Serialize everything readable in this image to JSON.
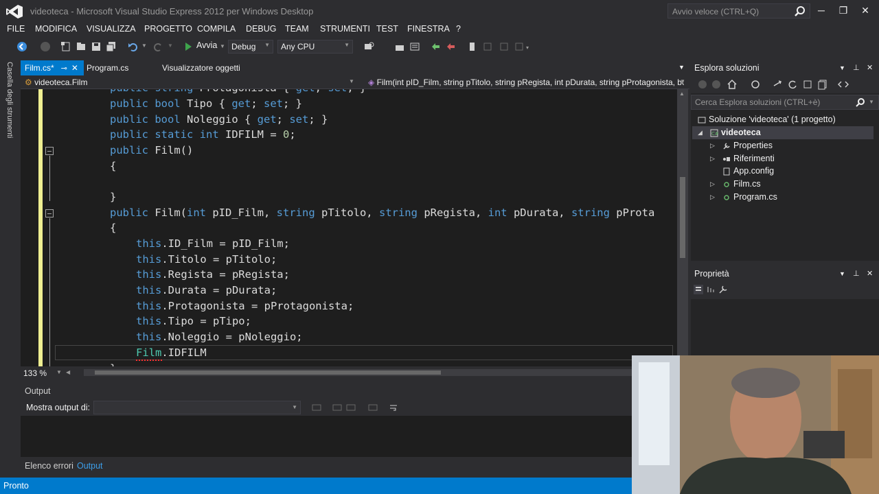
{
  "window": {
    "title": "videoteca - Microsoft Visual Studio Express 2012 per Windows Desktop",
    "quick_launch_placeholder": "Avvio veloce (CTRL+Q)"
  },
  "menu": [
    "FILE",
    "MODIFICA",
    "VISUALIZZA",
    "PROGETTO",
    "COMPILA",
    "DEBUG",
    "TEAM",
    "STRUMENTI",
    "TEST",
    "FINESTRA",
    "?"
  ],
  "toolbar": {
    "start_label": "Avvia",
    "configuration": "Debug",
    "platform": "Any CPU"
  },
  "toolbox_label": "Casella degli strumenti",
  "tabs": [
    {
      "label": "Film.cs*",
      "active": true
    },
    {
      "label": "Program.cs",
      "active": false
    },
    {
      "label": "Visualizzatore oggetti",
      "active": false
    }
  ],
  "navbar": {
    "type": "videoteca.Film",
    "member": "Film(int pID_Film, string pTitolo, string pRegista, int pDurata, string pProtagonista, bo"
  },
  "code": [
    "    public string Protagonista { get; set; }",
    "    public bool Tipo { get; set; }",
    "    public bool Noleggio { get; set; }",
    "    public static int IDFILM = 0;",
    "    public Film()",
    "    {",
    "",
    "    }",
    "    public Film(int pID_Film, string pTitolo, string pRegista, int pDurata, string pProta",
    "    {",
    "        this.ID_Film = pID_Film;",
    "        this.Titolo = pTitolo;",
    "        this.Regista = pRegista;",
    "        this.Durata = pDurata;",
    "        this.Protagonista = pProtagonista;",
    "        this.Tipo = pTipo;",
    "        this.Noleggio = pNoleggio;",
    "        Film.IDFILM",
    "    }"
  ],
  "editor": {
    "zoom": "133 %"
  },
  "output": {
    "title": "Output",
    "show_output_label": "Mostra output di:",
    "show_output_value": ""
  },
  "bottom_tabs": [
    "Elenco errori",
    "Output"
  ],
  "status": "Pronto",
  "solution_explorer": {
    "title": "Esplora soluzioni",
    "search_placeholder": "Cerca Esplora soluzioni (CTRL+è)",
    "items": [
      {
        "label": "Soluzione 'videoteca'  (1 progetto)",
        "level": 0,
        "expander": "",
        "icon": "solution-icon"
      },
      {
        "label": "videoteca",
        "level": 1,
        "expander": "◢",
        "icon": "csharp-project-icon"
      },
      {
        "label": "Properties",
        "level": 2,
        "expander": "▷",
        "icon": "wrench-icon"
      },
      {
        "label": "Riferimenti",
        "level": 2,
        "expander": "▷",
        "icon": "references-icon"
      },
      {
        "label": "App.config",
        "level": 2,
        "expander": "",
        "icon": "config-file-icon"
      },
      {
        "label": "Film.cs",
        "level": 2,
        "expander": "▷",
        "icon": "csharp-file-icon"
      },
      {
        "label": "Program.cs",
        "level": 2,
        "expander": "▷",
        "icon": "csharp-file-icon"
      }
    ]
  },
  "properties": {
    "title": "Proprietà"
  },
  "colors": {
    "accent": "#007acc",
    "keyword": "#569cd6",
    "type": "#4ec9b0",
    "editor_bg": "#1e1e1e",
    "chrome_bg": "#2d2d30"
  }
}
